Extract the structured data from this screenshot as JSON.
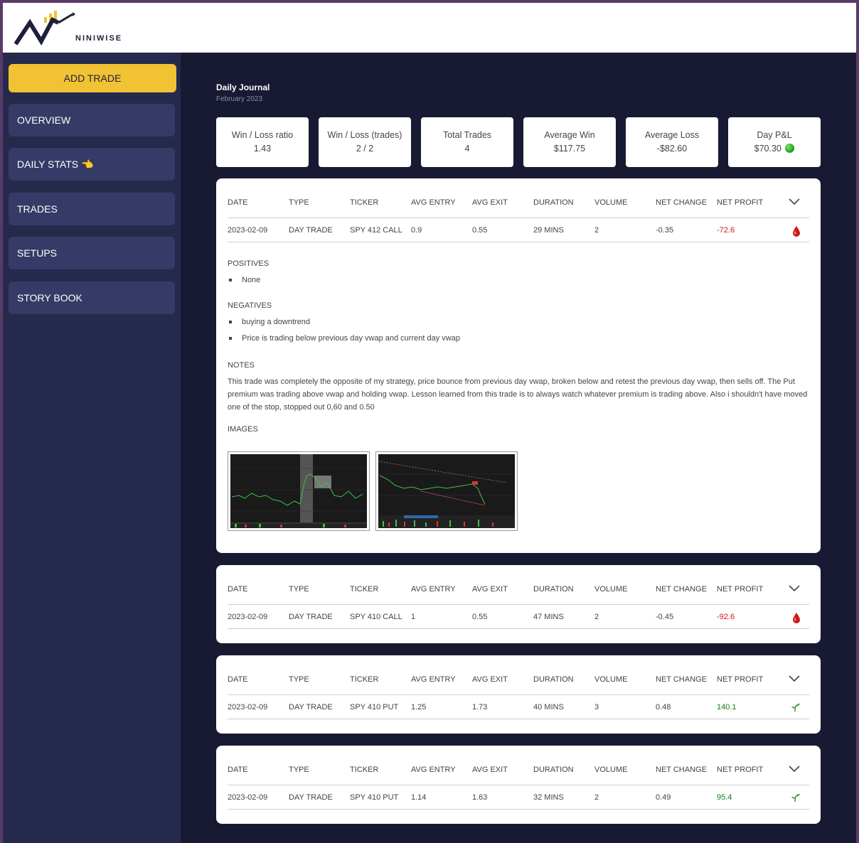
{
  "brand": {
    "name": "NINIWISE"
  },
  "sidebar": {
    "add_trade": "ADD TRADE",
    "items": [
      {
        "label": "OVERVIEW"
      },
      {
        "label": "DAILY STATS 👈"
      },
      {
        "label": "TRADES"
      },
      {
        "label": "SETUPS"
      },
      {
        "label": "STORY BOOK"
      }
    ]
  },
  "journal": {
    "title": "Daily Journal",
    "subtitle": "February 2023"
  },
  "stats": [
    {
      "label": "Win / Loss ratio",
      "value": "1.43"
    },
    {
      "label": "Win / Loss (trades)",
      "value": "2 / 2"
    },
    {
      "label": "Total Trades",
      "value": "4"
    },
    {
      "label": "Average Win",
      "value": "$117.75"
    },
    {
      "label": "Average Loss",
      "value": "-$82.60"
    },
    {
      "label": "Day P&L",
      "value": "$70.30"
    }
  ],
  "table_headers": [
    "DATE",
    "TYPE",
    "TICKER",
    "AVG ENTRY",
    "AVG EXIT",
    "DURATION",
    "VOLUME",
    "NET CHANGE",
    "NET PROFIT"
  ],
  "trades": [
    {
      "date": "2023-02-09",
      "type": "DAY TRADE",
      "ticker": "SPY 412 CALL",
      "avg_entry": "0.9",
      "avg_exit": "0.55",
      "duration": "29 MINS",
      "volume": "2",
      "net_change": "-0.35",
      "net_profit": "-72.6",
      "result_icon": "blood-drop-icon"
    },
    {
      "date": "2023-02-09",
      "type": "DAY TRADE",
      "ticker": "SPY 410 CALL",
      "avg_entry": "1",
      "avg_exit": "0.55",
      "duration": "47 MINS",
      "volume": "2",
      "net_change": "-0.45",
      "net_profit": "-92.6",
      "result_icon": "blood-drop-icon"
    },
    {
      "date": "2023-02-09",
      "type": "DAY TRADE",
      "ticker": "SPY 410 PUT",
      "avg_entry": "1.25",
      "avg_exit": "1.73",
      "duration": "40 MINS",
      "volume": "3",
      "net_change": "0.48",
      "net_profit": "140.1",
      "result_icon": "seedling-icon"
    },
    {
      "date": "2023-02-09",
      "type": "DAY TRADE",
      "ticker": "SPY 410 PUT",
      "avg_entry": "1.14",
      "avg_exit": "1.63",
      "duration": "32 MINS",
      "volume": "2",
      "net_change": "0.49",
      "net_profit": "95.4",
      "result_icon": "seedling-icon"
    }
  ],
  "details": {
    "positives_title": "POSITIVES",
    "positives": [
      "None"
    ],
    "negatives_title": "NEGATIVES",
    "negatives": [
      "buying a downtrend",
      "Price is trading below previous day vwap and current day vwap"
    ],
    "notes_title": "NOTES",
    "notes": "This trade was completely the opposite of my strategy, price bounce from previous day vwap, broken below and retest the previous day vwap, then sells off. The Put premium was trading above vwap and holding vwap. Lesson learned from this trade is to always watch whatever premium is trading above. Also i shouldn't have moved one of the stop, stopped out 0,60 and 0.50",
    "images_title": "IMAGES"
  },
  "colors": {
    "accent": "#f0c234",
    "sidebar_bg": "#252a4d",
    "nav_item_bg": "#353b66",
    "main_bg": "#181a33",
    "loss": "#d01818",
    "profit": "#1a7a1a"
  }
}
